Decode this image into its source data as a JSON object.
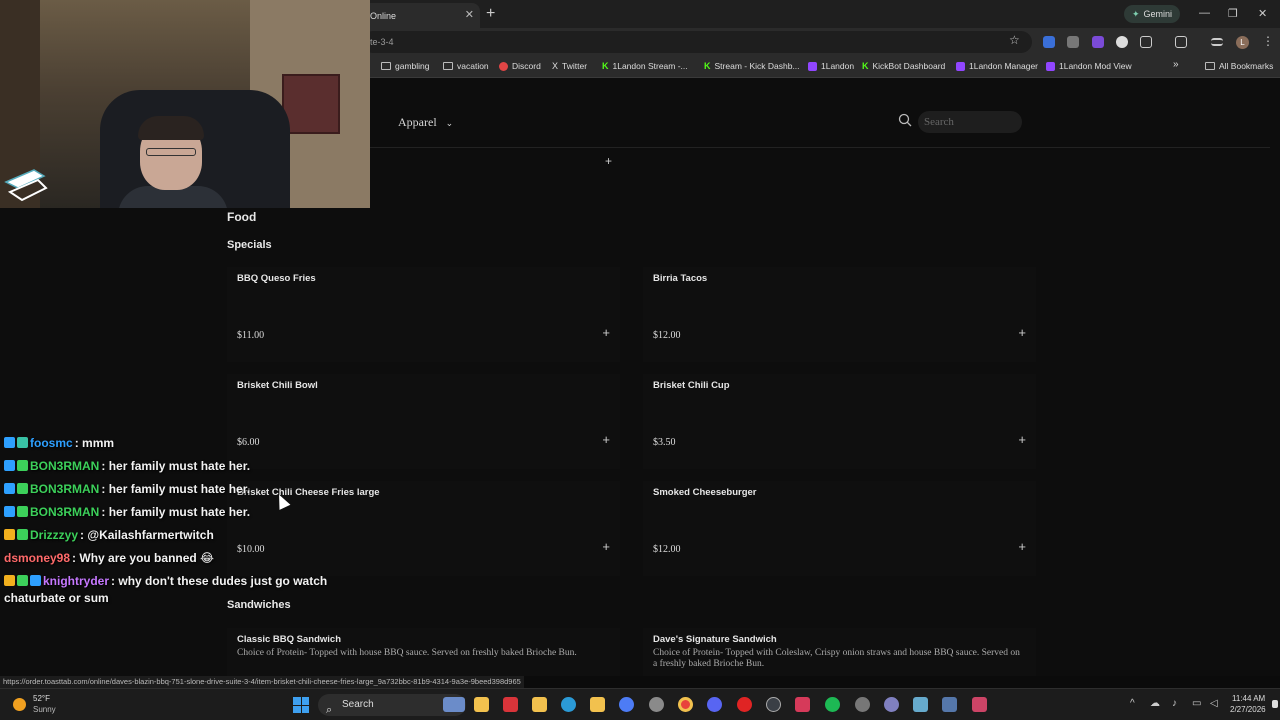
{
  "browser": {
    "tab_title": "Online",
    "tab_close": "✕",
    "new_tab": "+",
    "gemini_label": "Gemini",
    "url_fragment": "te-3-4",
    "window_controls": [
      "—",
      "❐",
      "✕"
    ],
    "bookmarks": [
      {
        "label": "gambling",
        "icon": "folder-icon",
        "color": "#bbbbbb"
      },
      {
        "label": "vacation",
        "icon": "folder-icon",
        "color": "#bbbbbb"
      },
      {
        "label": "Discord",
        "icon": "discord-icon",
        "color": "#e04545"
      },
      {
        "label": "Twitter",
        "icon": "x-icon",
        "color": "#dddddd"
      },
      {
        "label": "1Landon Stream -...",
        "icon": "kick-icon",
        "color": "#53fc18"
      },
      {
        "label": "Stream - Kick Dashb...",
        "icon": "kick-icon",
        "color": "#53fc18"
      },
      {
        "label": "1Landon",
        "icon": "twitch-icon",
        "color": "#9146ff"
      },
      {
        "label": "KickBot Dashboard",
        "icon": "kick-icon",
        "color": "#53fc18"
      },
      {
        "label": "1Landon Manager",
        "icon": "twitch-icon",
        "color": "#9146ff"
      },
      {
        "label": "1Landon Mod View",
        "icon": "twitch-icon",
        "color": "#9146ff"
      }
    ],
    "bookmarks_overflow": "»",
    "all_bookmarks": "All Bookmarks",
    "status_url": "https://order.toasttab.com/online/daves-blazin-bbq-751-slone-drive-suite-3-4/item-brisket-chili-cheese-fries-large_9a732bbc-81b9-4314-9a3e-9beed398d965",
    "avatar_letter": "L"
  },
  "page": {
    "nav_apparel": "Apparel",
    "search_placeholder": "Search",
    "top_plus": "+",
    "food_heading": "Food",
    "specials_heading": "Specials",
    "sandwiches_heading": "Sandwiches",
    "specials": [
      {
        "name": "BBQ Queso Fries",
        "price": "$11.00",
        "desc": ""
      },
      {
        "name": "Birria Tacos",
        "price": "$12.00",
        "desc": ""
      },
      {
        "name": "Brisket Chili Bowl",
        "price": "$6.00",
        "desc": ""
      },
      {
        "name": "Brisket Chili Cup",
        "price": "$3.50",
        "desc": ""
      },
      {
        "name": "Brisket Chili Cheese Fries large",
        "price": "$10.00",
        "desc": ""
      },
      {
        "name": "Smoked Cheeseburger",
        "price": "$12.00",
        "desc": ""
      }
    ],
    "sandwiches": [
      {
        "name": "Classic BBQ Sandwich",
        "desc": "Choice of Protein- Topped with house BBQ sauce. Served on freshly baked Brioche Bun."
      },
      {
        "name": "Dave's Signature Sandwich",
        "desc": "Choice of Protein- Topped with Coleslaw, Crispy onion straws and house BBQ sauce. Served on a freshly baked Brioche Bun."
      }
    ],
    "plus_symbol": "+"
  },
  "chat": [
    {
      "user": "foosmc",
      "color": "#2ea0ff",
      "message": "mmm"
    },
    {
      "user": "BON3RMAN",
      "color": "#3cd05a",
      "message": "her family must hate her."
    },
    {
      "user": "BON3RMAN",
      "color": "#3cd05a",
      "message": "her family must hate her."
    },
    {
      "user": "BON3RMAN",
      "color": "#3cd05a",
      "message": "her family must hate her."
    },
    {
      "user": "Drizzzyy",
      "color": "#3cd05a",
      "message": "@Kailashfarmertwitch"
    },
    {
      "user": "dsmoney98",
      "color": "#ff6a6a",
      "message": "Why are you banned 😂"
    },
    {
      "user": "knightryder",
      "color": "#c678ff",
      "message": "why don't these dudes just go watch chaturbate or sum"
    }
  ],
  "taskbar": {
    "temperature": "52°F",
    "weather": "Sunny",
    "search_label": "Search",
    "time": "11:44 AM",
    "date": "2/27/2026",
    "apps": [
      {
        "icon": "widgets-icon",
        "color": "#6b8cc9"
      },
      {
        "icon": "file-explorer-icon",
        "color": "#f2c14e"
      },
      {
        "icon": "adobe-icon",
        "color": "#d9343a"
      },
      {
        "icon": "folder-icon",
        "color": "#f2c14e"
      },
      {
        "icon": "edge-icon",
        "color": "#2b9ad6"
      },
      {
        "icon": "store-icon",
        "color": "#f2c14e"
      },
      {
        "icon": "vpn-icon",
        "color": "#4d7cf5"
      },
      {
        "icon": "settings-icon",
        "color": "#8a8a8a"
      },
      {
        "icon": "chrome-icon",
        "color": "#e8433c"
      },
      {
        "icon": "discord-icon",
        "color": "#5865f2"
      },
      {
        "icon": "youtube-icon",
        "color": "#e02424"
      },
      {
        "icon": "steam-icon",
        "color": "#3a3f46"
      },
      {
        "icon": "app-icon",
        "color": "#d63a5a"
      },
      {
        "icon": "spotify-icon",
        "color": "#1db954"
      },
      {
        "icon": "obs-icon",
        "color": "#777777"
      },
      {
        "icon": "streamlabs-icon",
        "color": "#8080c0"
      },
      {
        "icon": "tool-icon",
        "color": "#66aacc"
      },
      {
        "icon": "calculator-icon",
        "color": "#5577aa"
      },
      {
        "icon": "shield-icon",
        "color": "#cc4466"
      }
    ]
  }
}
